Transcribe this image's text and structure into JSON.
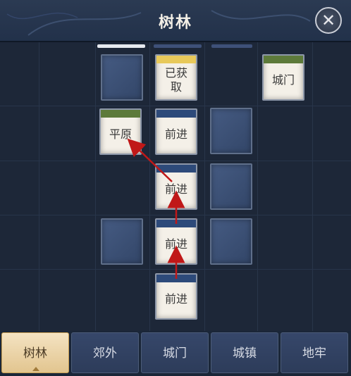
{
  "header": {
    "title": "树林"
  },
  "close_button": {
    "glyph": "✕"
  },
  "map": {
    "cards": [
      {
        "label": "已获取",
        "cap_color": "#e8c95a"
      },
      {
        "label": "城门",
        "cap_color": "#5d7a3a"
      },
      {
        "label": "平原",
        "cap_color": "#5d7a3a"
      },
      {
        "label": "前进",
        "cap_color": "#2d4a7a"
      },
      {
        "label": "前进",
        "cap_color": "#2d4a7a"
      },
      {
        "label": "前进",
        "cap_color": "#2d4a7a"
      },
      {
        "label": "前进",
        "cap_color": "#2d4a7a"
      }
    ],
    "path_color": "#c01818"
  },
  "tabs": [
    {
      "label": "树林",
      "active": true
    },
    {
      "label": "郊外",
      "active": false
    },
    {
      "label": "城门",
      "active": false
    },
    {
      "label": "城镇",
      "active": false
    },
    {
      "label": "地牢",
      "active": false
    }
  ]
}
